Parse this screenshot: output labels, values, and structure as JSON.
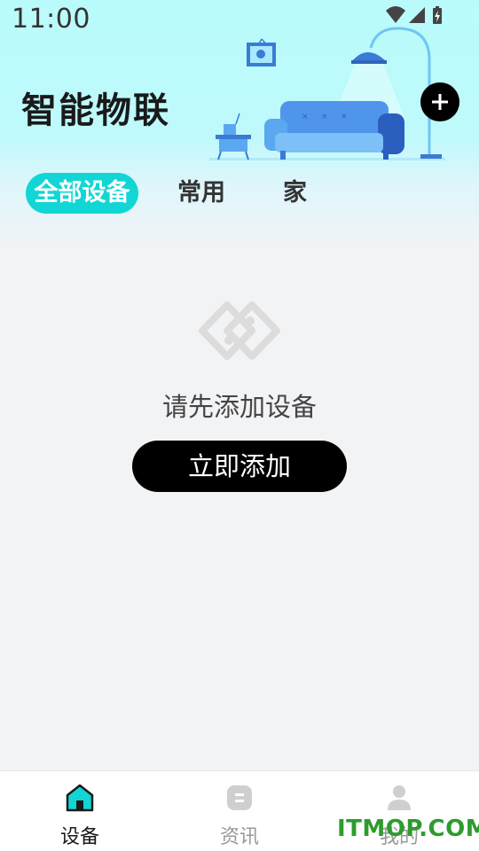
{
  "status_bar": {
    "time": "11:00",
    "icons": [
      "wifi-icon",
      "signal-icon",
      "battery-icon"
    ]
  },
  "header": {
    "title": "智能物联",
    "add_icon": "plus-icon"
  },
  "tabs": [
    {
      "label": "全部设备",
      "active": true
    },
    {
      "label": "常用",
      "active": false
    },
    {
      "label": "家",
      "active": false
    }
  ],
  "empty_state": {
    "icon": "link-icon",
    "message": "请先添加设备",
    "button_label": "立即添加"
  },
  "bottom_nav": [
    {
      "label": "设备",
      "icon": "home-icon",
      "active": true
    },
    {
      "label": "资讯",
      "icon": "news-icon",
      "active": false
    },
    {
      "label": "我的",
      "icon": "user-icon",
      "active": false
    }
  ],
  "watermark": "ITMOP.COM",
  "colors": {
    "accent": "#12d6d6",
    "header_bg": "#b9fbfb",
    "button_bg": "#000000",
    "page_bg": "#f2f3f5"
  }
}
